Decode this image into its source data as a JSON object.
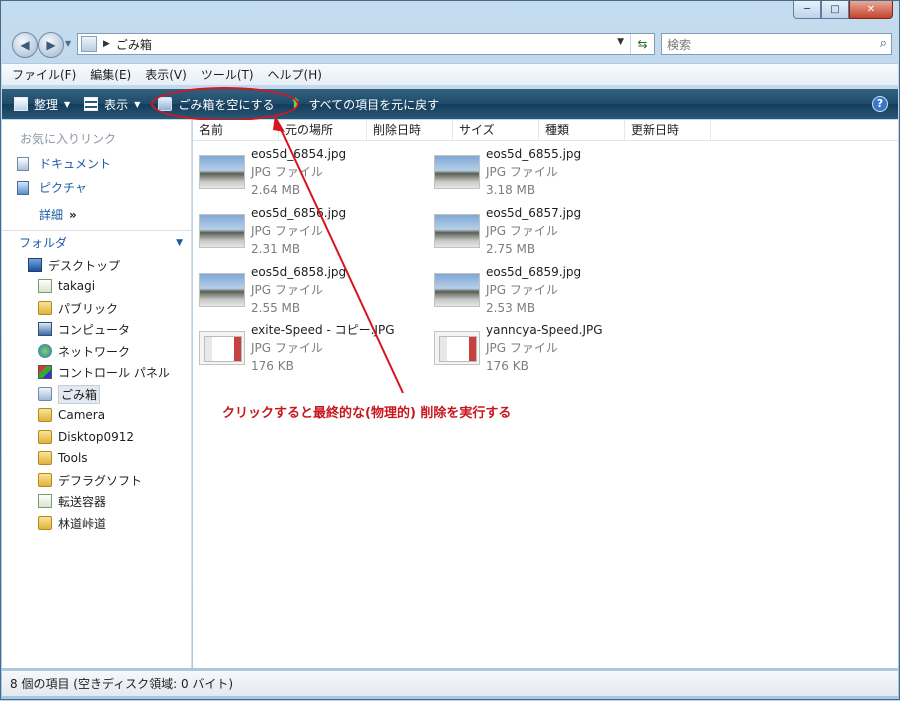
{
  "window": {
    "path": "ごみ箱",
    "search_placeholder": "検索",
    "caption": {
      "minimize": "─",
      "maximize": "□",
      "close": "✕"
    }
  },
  "menu": [
    "ファイル(F)",
    "編集(E)",
    "表示(V)",
    "ツール(T)",
    "ヘルプ(H)"
  ],
  "commands": {
    "organize": "整理",
    "view": "表示",
    "empty_bin": "ごみ箱を空にする",
    "restore_all": "すべての項目を元に戻す",
    "help": "?"
  },
  "nav": {
    "favorites_title": "お気に入りリンク",
    "favorites": [
      "ドキュメント",
      "ピクチャ"
    ],
    "more": "詳細",
    "more_chevron": "»",
    "folders_title": "フォルダ",
    "tree": [
      "デスクトップ",
      "takagi",
      "パブリック",
      "コンピュータ",
      "ネットワーク",
      "コントロール パネル",
      "ごみ箱",
      "Camera",
      "Disktop0912",
      "Tools",
      "デフラグソフト",
      "転送容器",
      "林道峠道"
    ]
  },
  "columns": [
    "名前",
    "元の場所",
    "削除日時",
    "サイズ",
    "種類",
    "更新日時"
  ],
  "files": [
    {
      "name": "eos5d_6854.jpg",
      "type": "JPG ファイル",
      "size": "2.64 MB"
    },
    {
      "name": "eos5d_6855.jpg",
      "type": "JPG ファイル",
      "size": "3.18 MB"
    },
    {
      "name": "eos5d_6856.jpg",
      "type": "JPG ファイル",
      "size": "2.31 MB"
    },
    {
      "name": "eos5d_6857.jpg",
      "type": "JPG ファイル",
      "size": "2.75 MB"
    },
    {
      "name": "eos5d_6858.jpg",
      "type": "JPG ファイル",
      "size": "2.55 MB"
    },
    {
      "name": "eos5d_6859.jpg",
      "type": "JPG ファイル",
      "size": "2.53 MB"
    },
    {
      "name": "exite-Speed - コピー.JPG",
      "type": "JPG ファイル",
      "size": "176 KB"
    },
    {
      "name": "yanncya-Speed.JPG",
      "type": "JPG ファイル",
      "size": "176 KB"
    }
  ],
  "annotation": "クリックすると最終的な(物理的) 削除を実行する",
  "status": "8 個の項目 (空きディスク領域: 0 バイト)",
  "colors": {
    "annotation": "#c8161d",
    "command_bar": "#1f4b6a",
    "link": "#1b5aa6"
  }
}
